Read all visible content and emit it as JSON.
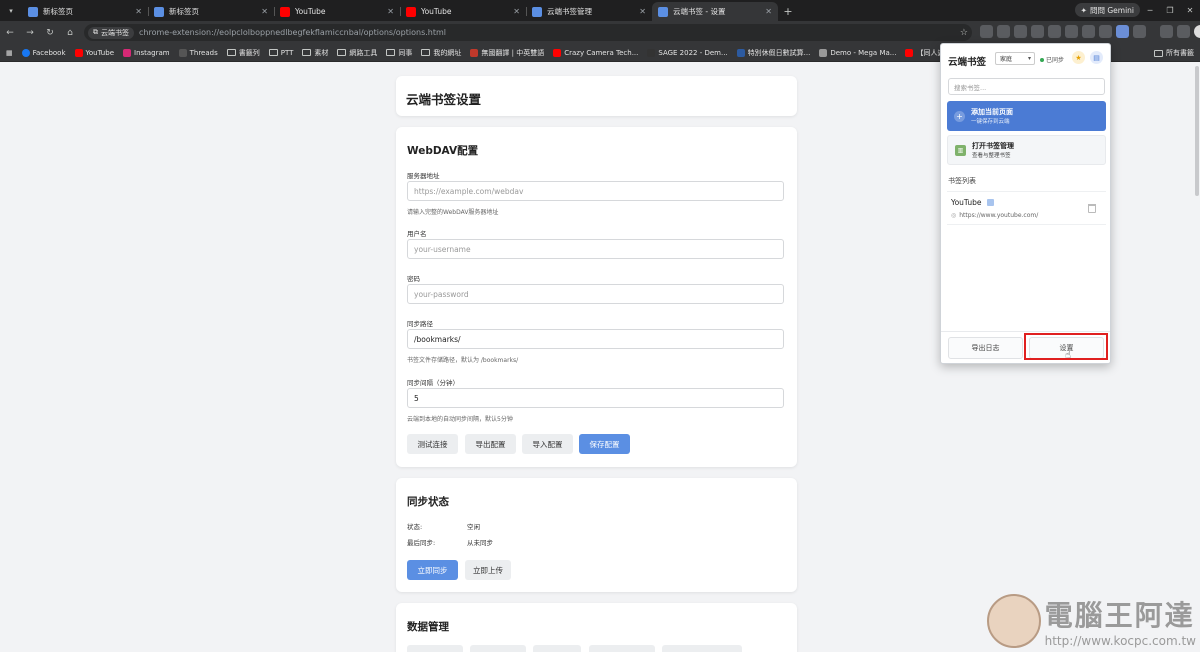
{
  "tabs": [
    {
      "title": "新标签页",
      "icon": "newtab-icon",
      "color": "#5b8fe3",
      "active": false
    },
    {
      "title": "新标签页",
      "icon": "newtab-icon",
      "color": "#5b8fe3",
      "active": false
    },
    {
      "title": "YouTube",
      "icon": "youtube-icon",
      "color": "#ff0000",
      "active": false
    },
    {
      "title": "YouTube",
      "icon": "youtube-icon",
      "color": "#ff0000",
      "active": false
    },
    {
      "title": "云端书签管理",
      "icon": "cloud-bookmark-icon",
      "color": "#5b8fe3",
      "active": false
    },
    {
      "title": "云端书签 - 设置",
      "icon": "cloud-bookmark-icon",
      "color": "#5b8fe3",
      "active": true
    }
  ],
  "gemini_label": "問問 Gemini",
  "omnibox": {
    "chip": "云端书签",
    "url": "chrome-extension://eolpclolboppnedlbegfekflamiccnbal/options/options.html"
  },
  "bookmarks": [
    {
      "label": "Facebook",
      "type": "site",
      "color": "#1877f2"
    },
    {
      "label": "YouTube",
      "type": "site",
      "color": "#ff0000"
    },
    {
      "label": "Instagram",
      "type": "site",
      "color": "#d62976"
    },
    {
      "label": "Threads",
      "type": "site",
      "color": "#444444"
    },
    {
      "label": "書籤列",
      "type": "folder"
    },
    {
      "label": "PTT",
      "type": "folder"
    },
    {
      "label": "素材",
      "type": "folder"
    },
    {
      "label": "網路工具",
      "type": "folder"
    },
    {
      "label": "同事",
      "type": "folder"
    },
    {
      "label": "我的網址",
      "type": "folder"
    },
    {
      "label": "無國翻譯 | 中英雙語",
      "type": "site",
      "color": "#c0392b"
    },
    {
      "label": "Crazy Camera Tech...",
      "type": "site",
      "color": "#ff0000"
    },
    {
      "label": "SAGE 2022 - Dem...",
      "type": "site",
      "color": "#333333"
    },
    {
      "label": "特別休假日數試算...",
      "type": "site",
      "color": "#2c5aa0"
    },
    {
      "label": "Demo - Mega Ma...",
      "type": "site",
      "color": "#999999"
    },
    {
      "label": "【同人遊戲】可以...",
      "type": "site",
      "color": "#ff0000"
    }
  ],
  "all_bookmarks": "所有書籤",
  "settings": {
    "title": "云端书签设置",
    "webdav": {
      "heading": "WebDAV配置",
      "server_label": "服务器地址",
      "server_placeholder": "https://example.com/webdav",
      "server_help": "请输入完整的WebDAV服务器地址",
      "user_label": "用户名",
      "user_placeholder": "your-username",
      "pass_label": "密码",
      "pass_placeholder": "your-password",
      "path_label": "同步路径",
      "path_value": "/bookmarks/",
      "path_help": "书签文件存储路径，默认为 /bookmarks/",
      "interval_label": "同步间隔（分钟）",
      "interval_value": "5",
      "interval_help": "云端到本地的自动同步间隔，默认5分钟",
      "btn_test": "测试连接",
      "btn_export": "导出配置",
      "btn_import": "导入配置",
      "btn_save": "保存配置"
    },
    "sync": {
      "heading": "同步状态",
      "status_key": "状态:",
      "status_val": "空闲",
      "last_key": "最后同步:",
      "last_val": "从未同步",
      "btn_sync": "立即同步",
      "btn_upload": "立即上传"
    },
    "data": {
      "heading": "数据管理"
    }
  },
  "popup": {
    "title": "云端书签",
    "select": "家庭",
    "status": "已同步",
    "search_placeholder": "搜索书签...",
    "add_title": "添加当前页面",
    "add_sub": "一键保存到云端",
    "manage_title": "打开书签管理",
    "manage_sub": "查看与整理书签",
    "list_heading": "书签列表",
    "item_name": "YouTube",
    "item_url": "https://www.youtube.com/",
    "btn_log": "导出日志",
    "btn_settings": "设置"
  },
  "watermark": {
    "title": "電腦王阿達",
    "url": "http://www.kocpc.com.tw"
  },
  "colors": {
    "accent": "#5b8fe3",
    "popup_accent": "#4b7bd4",
    "highlight": "#e02020"
  }
}
